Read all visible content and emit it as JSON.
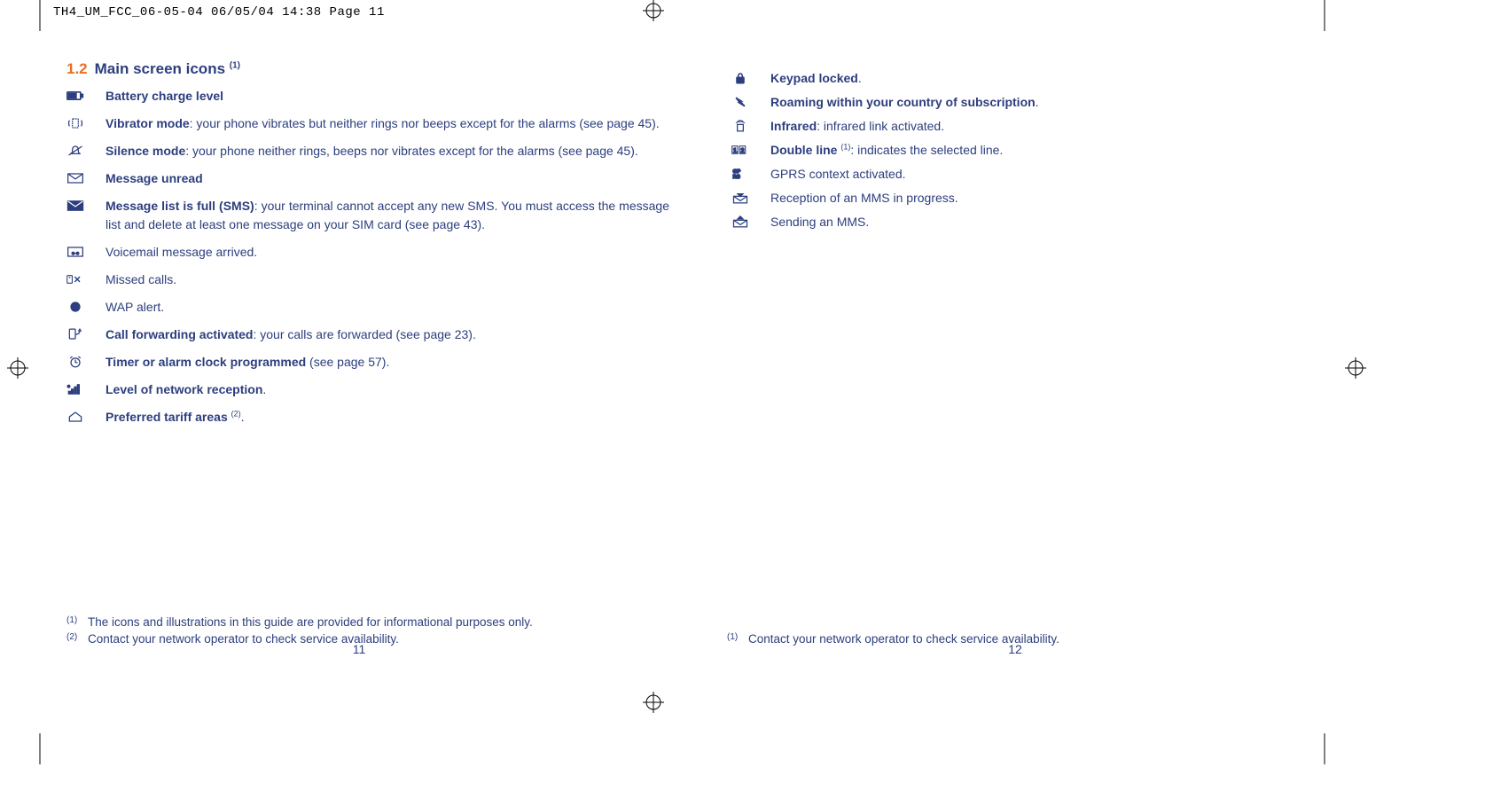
{
  "header": "TH4_UM_FCC_06-05-04  06/05/04  14:38  Page 11",
  "section": {
    "num": "1.2",
    "title": "Main screen icons",
    "sup": "(1)"
  },
  "left_items": [
    {
      "icon": "battery",
      "bold": "Battery charge level",
      "rest": ""
    },
    {
      "icon": "vibrate",
      "bold": "Vibrator mode",
      "rest": ": your phone vibrates but neither rings nor beeps except for the alarms (see page 45).",
      "justify": true
    },
    {
      "icon": "silence",
      "bold": "Silence mode",
      "rest": ": your phone neither rings, beeps nor vibrates except for the alarms (see page 45)."
    },
    {
      "icon": "envelope",
      "bold": "Message unread",
      "rest": ""
    },
    {
      "icon": "envelope-fill",
      "bold": "Message list is full (SMS)",
      "rest": ": your terminal cannot accept any new SMS. You must access the message list and delete at least one message on your SIM card (see page 43).",
      "justify": true
    },
    {
      "icon": "voicemail",
      "bold": "",
      "rest": "Voicemail message arrived."
    },
    {
      "icon": "missed",
      "bold": "",
      "rest": "Missed calls."
    },
    {
      "icon": "wap",
      "bold": "",
      "rest": "WAP alert."
    },
    {
      "icon": "forward",
      "bold": "Call forwarding activated",
      "rest": ": your calls are forwarded (see page 23)."
    },
    {
      "icon": "alarm",
      "bold": "Timer or alarm clock programmed",
      "rest": " (see page 57)."
    },
    {
      "icon": "signal",
      "bold": "Level of network reception",
      "rest": "."
    },
    {
      "icon": "home",
      "bold": "Preferred tariff areas ",
      "rest": ".",
      "sup": "(2)"
    }
  ],
  "right_items": [
    {
      "icon": "lock",
      "bold": "Keypad locked",
      "rest": "."
    },
    {
      "icon": "roaming",
      "bold": "Roaming within your country of subscription",
      "rest": "."
    },
    {
      "icon": "infrared",
      "bold": "Infrared",
      "rest": ": infrared link activated."
    },
    {
      "icon": "double-line",
      "bold": "Double line ",
      "rest": ": indicates the selected line.",
      "sup": "(1)"
    },
    {
      "icon": "gprs",
      "bold": "",
      "rest": "GPRS context activated."
    },
    {
      "icon": "mms-in",
      "bold": "",
      "rest": "Reception of an MMS in progress."
    },
    {
      "icon": "mms-out",
      "bold": "",
      "rest": "Sending an MMS."
    }
  ],
  "footnotes_left": [
    {
      "mark": "(1)",
      "text": "The icons and illustrations in this guide are provided for informational purposes only."
    },
    {
      "mark": "(2)",
      "text": "Contact your network operator to check service availability."
    }
  ],
  "footnotes_right": [
    {
      "mark": "(1)",
      "text": "Contact your network operator to check service availability."
    }
  ],
  "page_num_left": "11",
  "page_num_right": "12"
}
